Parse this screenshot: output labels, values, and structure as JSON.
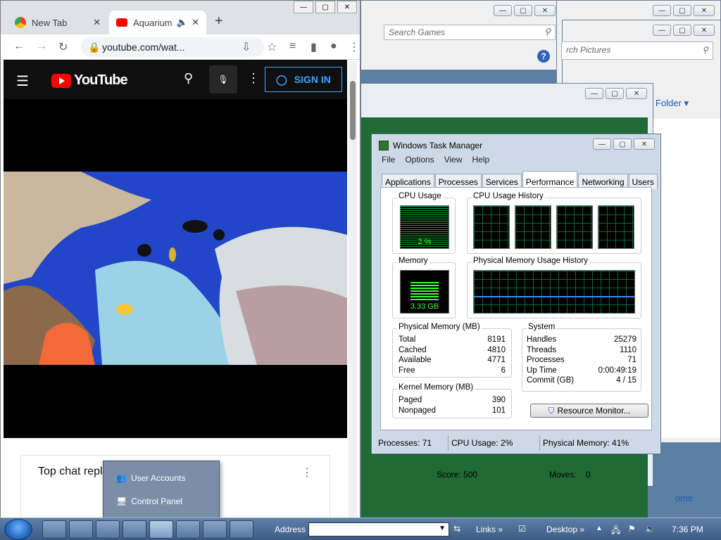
{
  "games_window": {
    "search_placeholder": "Search Games"
  },
  "pictures_window": {
    "search_placeholder": "rch Pictures",
    "folder_label": "Folder",
    "partial_text": "ome"
  },
  "chrome": {
    "tabs": [
      {
        "label": "New Tab"
      },
      {
        "label": "Aquarium"
      }
    ],
    "url": "youtube.com/wat...",
    "youtube": {
      "logo_text": "YouTube",
      "sign_in_label": "SIGN IN"
    },
    "chat_title": "Top chat repl"
  },
  "popup_menu": {
    "items": [
      {
        "label": "User Accounts"
      },
      {
        "label": "Control Panel"
      }
    ]
  },
  "solitaire": {
    "score": "Score: 500",
    "moves_label": "Moves:",
    "moves_value": "0"
  },
  "task_manager": {
    "title": "Windows Task Manager",
    "menu": [
      "File",
      "Options",
      "View",
      "Help"
    ],
    "tabs": [
      "Applications",
      "Processes",
      "Services",
      "Performance",
      "Networking",
      "Users"
    ],
    "active_tab": "Performance",
    "cpu_usage": {
      "label": "CPU Usage",
      "value": "2 %"
    },
    "cpu_history_label": "CPU Usage History",
    "memory": {
      "label": "Memory",
      "value": "3.33 GB"
    },
    "mem_history_label": "Physical Memory Usage History",
    "physical_memory": {
      "label": "Physical Memory (MB)",
      "rows": [
        {
          "k": "Total",
          "v": "8191"
        },
        {
          "k": "Cached",
          "v": "4810"
        },
        {
          "k": "Available",
          "v": "4771"
        },
        {
          "k": "Free",
          "v": "6"
        }
      ]
    },
    "kernel_memory": {
      "label": "Kernel Memory (MB)",
      "rows": [
        {
          "k": "Paged",
          "v": "390"
        },
        {
          "k": "Nonpaged",
          "v": "101"
        }
      ]
    },
    "system": {
      "label": "System",
      "rows": [
        {
          "k": "Handles",
          "v": "25279"
        },
        {
          "k": "Threads",
          "v": "1110"
        },
        {
          "k": "Processes",
          "v": "71"
        },
        {
          "k": "Up Time",
          "v": "0:00:49:19"
        },
        {
          "k": "Commit (GB)",
          "v": "4 / 15"
        }
      ]
    },
    "resource_monitor_label": "Resource Monitor...",
    "status": {
      "processes": "Processes: 71",
      "cpu": "CPU Usage: 2%",
      "memory": "Physical Memory: 41%"
    }
  },
  "taskbar": {
    "address_label": "Address",
    "links_label": "Links",
    "desktop_label": "Desktop",
    "clock": "7:36 PM"
  }
}
